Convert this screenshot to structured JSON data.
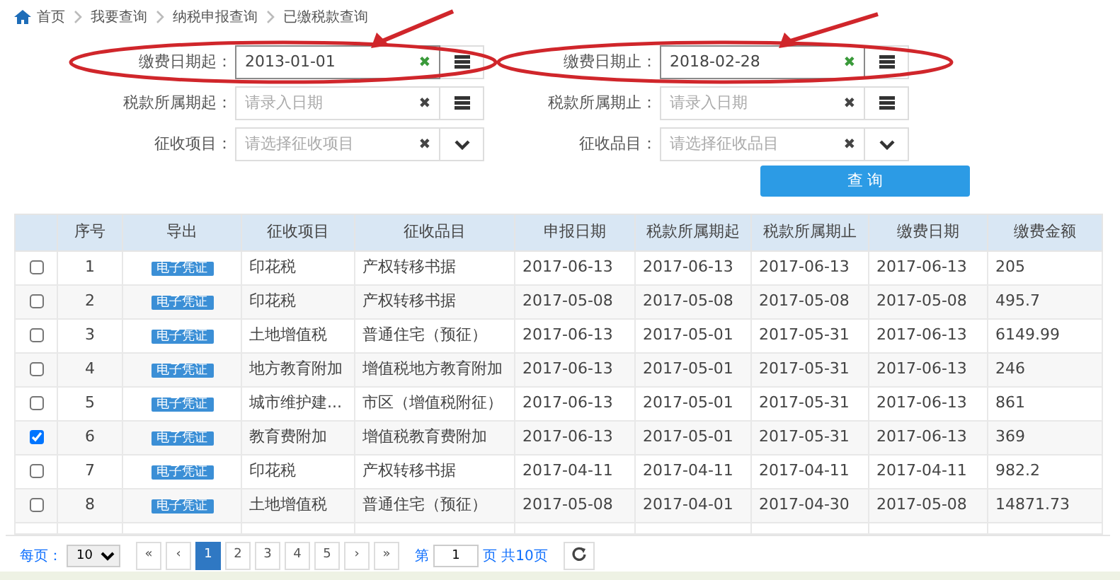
{
  "breadcrumb": [
    "首页",
    "我要查询",
    "纳税申报查询",
    "已缴税款查询"
  ],
  "filters": [
    {
      "label": "缴费日期起：",
      "value": "2013-01-01",
      "kind": "date",
      "highlighted": true
    },
    {
      "label": "缴费日期止：",
      "value": "2018-02-28",
      "kind": "date",
      "highlighted": true
    },
    {
      "label": "税款所属期起：",
      "placeholder": "请录入日期",
      "kind": "date",
      "highlighted": false
    },
    {
      "label": "税款所属期止：",
      "placeholder": "请录入日期",
      "kind": "date",
      "highlighted": false
    },
    {
      "label": "征收项目：",
      "placeholder": "请选择征收项目",
      "kind": "select",
      "highlighted": false
    },
    {
      "label": "征收品目：",
      "placeholder": "请选择征收品目",
      "kind": "select",
      "highlighted": false
    }
  ],
  "clear_icon": "✖",
  "query_button": "查 询",
  "table": {
    "columns": [
      "序号",
      "导出",
      "征收项目",
      "征收品目",
      "申报日期",
      "税款所属期起",
      "税款所属期止",
      "缴费日期",
      "缴费金额"
    ],
    "rows": [
      {
        "checked": false,
        "cells": [
          "1",
          "电子凭证",
          "印花税",
          "产权转移书据",
          "2017-06-13",
          "2017-06-13",
          "2017-06-13",
          "2017-06-13",
          "205"
        ]
      },
      {
        "checked": false,
        "cells": [
          "2",
          "电子凭证",
          "印花税",
          "产权转移书据",
          "2017-05-08",
          "2017-05-08",
          "2017-05-08",
          "2017-05-08",
          "495.7"
        ]
      },
      {
        "checked": false,
        "cells": [
          "3",
          "电子凭证",
          "土地增值税",
          "普通住宅（预征）",
          "2017-06-13",
          "2017-05-01",
          "2017-05-31",
          "2017-06-13",
          "6149.99"
        ]
      },
      {
        "checked": false,
        "cells": [
          "4",
          "电子凭证",
          "地方教育附加",
          "增值税地方教育附加",
          "2017-06-13",
          "2017-05-01",
          "2017-05-31",
          "2017-06-13",
          "246"
        ]
      },
      {
        "checked": false,
        "cells": [
          "5",
          "电子凭证",
          "城市维护建...",
          "市区（增值税附征）",
          "2017-06-13",
          "2017-05-01",
          "2017-05-31",
          "2017-06-13",
          "861"
        ]
      },
      {
        "checked": true,
        "cells": [
          "6",
          "电子凭证",
          "教育费附加",
          "增值税教育费附加",
          "2017-06-13",
          "2017-05-01",
          "2017-05-31",
          "2017-06-13",
          "369"
        ]
      },
      {
        "checked": false,
        "cells": [
          "7",
          "电子凭证",
          "印花税",
          "产权转移书据",
          "2017-04-11",
          "2017-04-11",
          "2017-04-11",
          "2017-04-11",
          "982.2"
        ]
      },
      {
        "checked": false,
        "cells": [
          "8",
          "电子凭证",
          "土地增值税",
          "普通住宅（预征）",
          "2017-05-08",
          "2017-04-01",
          "2017-04-30",
          "2017-05-08",
          "14871.73"
        ]
      }
    ]
  },
  "pager": {
    "per_page_label": "每页：",
    "per_page": "10",
    "buttons": [
      {
        "label": "«",
        "selected": false
      },
      {
        "label": "‹",
        "selected": false
      },
      {
        "label": "1",
        "selected": true
      },
      {
        "label": "2",
        "selected": false
      },
      {
        "label": "3",
        "selected": false
      },
      {
        "label": "4",
        "selected": false
      },
      {
        "label": "5",
        "selected": false
      },
      {
        "label": "›",
        "selected": false
      },
      {
        "label": "»",
        "selected": false
      }
    ],
    "page_prefix": "第",
    "page_value": "1",
    "page_suffix": "页 共10页"
  }
}
